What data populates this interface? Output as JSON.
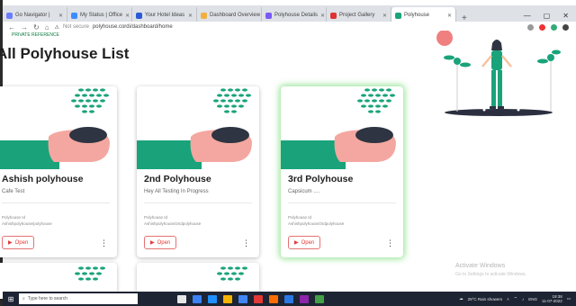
{
  "browser": {
    "tabs": [
      {
        "label": "Go Navigator |"
      },
      {
        "label": "My Status | Office"
      },
      {
        "label": "Your Hotel Ideas"
      },
      {
        "label": "Dashboard Overview"
      },
      {
        "label": "Polyhouse Details"
      },
      {
        "label": "Project Gallery"
      },
      {
        "label": "Polyhouse",
        "active": true
      }
    ],
    "address": {
      "security": "Not secure",
      "url": "polyhouse.cordi/dashboard/home"
    },
    "bookmark_label": "PRIVATE REFERENCE"
  },
  "page": {
    "title": "All Polyhouse List"
  },
  "cards": [
    {
      "title": "Ashish polyhouse",
      "description": "Cafe Test",
      "meta_line1": "Polyhouse Id",
      "meta_line2": "Ashishpolyhouse/polyhouse",
      "open_label": "Open"
    },
    {
      "title": "2nd Polyhouse",
      "description": "Hey All Testing In Progress",
      "meta_line1": "Polyhouse Id",
      "meta_line2": "Ashishpolyhouse/2ndpolyhouse",
      "open_label": "Open"
    },
    {
      "title": "3rd Polyhouse",
      "description": "Capsicum ....",
      "meta_line1": "Polyhouse Id",
      "meta_line2": "Ashishpolyhouse/3rdpolyhouse",
      "open_label": "Open",
      "highlighted": true
    }
  ],
  "watermark": {
    "line1": "Activate Windows",
    "line2": "Go to Settings to activate Windows."
  },
  "taskbar": {
    "search_placeholder": "Type here to search",
    "weather": "29°C Rain showers",
    "language": "ENG",
    "time": "19:38",
    "date": "11-07-2022"
  },
  "colors": {
    "accent_green": "#1aa37a",
    "pillow": "#f4a7a0",
    "hair": "#2e3441",
    "open_red": "#e53935",
    "highlight_glow": "#50d250"
  },
  "icons": [
    "back-icon",
    "forward-icon",
    "reload-icon",
    "home-icon",
    "lock-icon",
    "play-icon",
    "kebab-menu-icon",
    "windows-start-icon",
    "search-icon"
  ]
}
